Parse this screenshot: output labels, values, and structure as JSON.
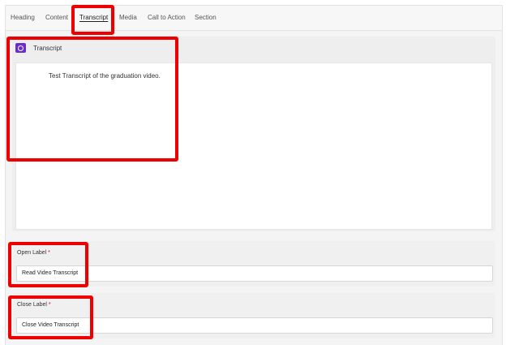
{
  "tabs": [
    {
      "label": "Heading"
    },
    {
      "label": "Content"
    },
    {
      "label": "Transcript",
      "active": true
    },
    {
      "label": "Media"
    },
    {
      "label": "Call to Action"
    },
    {
      "label": "Section"
    }
  ],
  "transcript_panel": {
    "title": "Transcript",
    "icon": "transcript-icon",
    "body_text": "Test Transcript of the graduation video."
  },
  "open_label_field": {
    "label": "Open Label",
    "required_mark": "*",
    "value": "Read Video Transcript"
  },
  "close_label_field": {
    "label": "Close Label",
    "required_mark": "*",
    "value": "Close Video Transcript"
  },
  "colors": {
    "highlight": "#ee0000",
    "icon_accent": "#6a2ccf",
    "required": "#d40000"
  }
}
